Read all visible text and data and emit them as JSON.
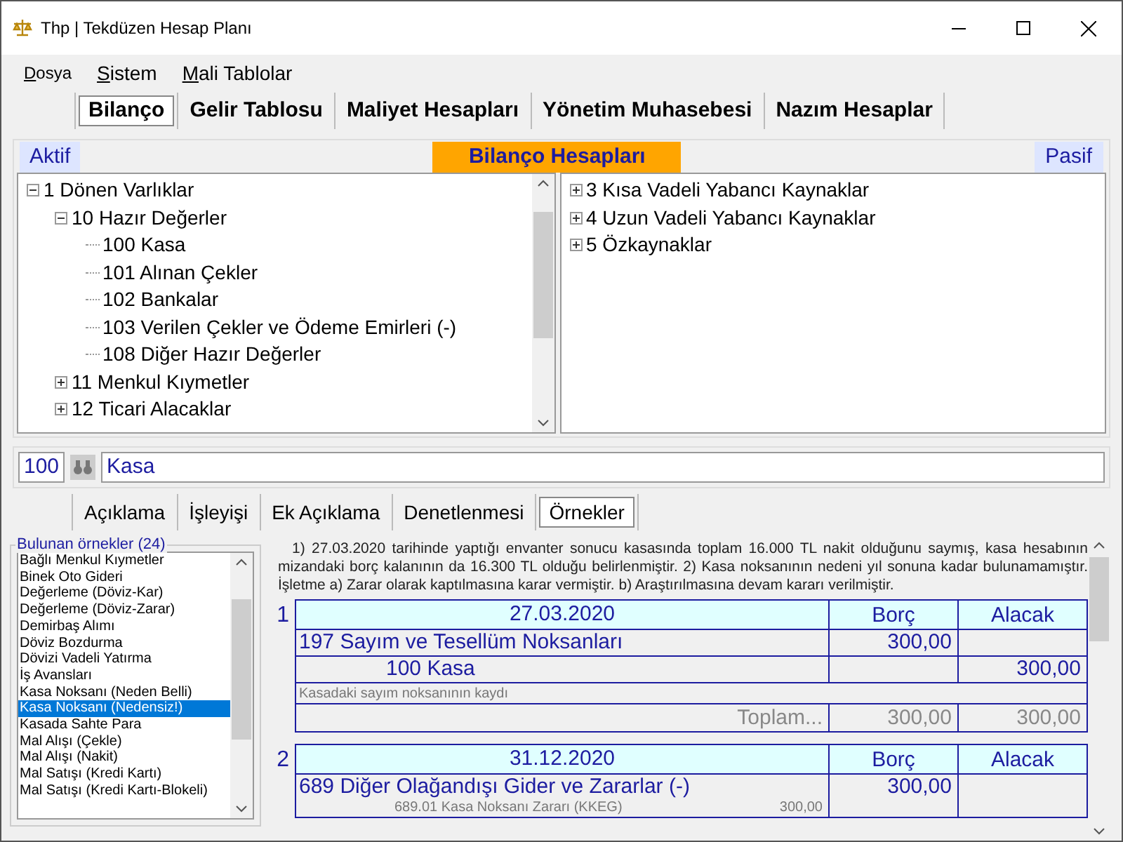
{
  "window": {
    "title": "Thp | Tekdüzen Hesap Planı"
  },
  "menu": [
    {
      "label": "Dosya",
      "kind": "small"
    },
    {
      "label": "Sistem",
      "kind": "normal"
    },
    {
      "label": "Mali Tablolar",
      "kind": "normal"
    }
  ],
  "tabs": [
    {
      "label": "Bilanço",
      "selected": true
    },
    {
      "label": "Gelir Tablosu",
      "selected": false
    },
    {
      "label": "Maliyet Hesapları",
      "selected": false
    },
    {
      "label": "Yönetim Muhasebesi",
      "selected": false
    },
    {
      "label": "Nazım Hesaplar",
      "selected": false
    }
  ],
  "balance_header": {
    "left": "Aktif",
    "title": "Bilanço Hesapları",
    "right": "Pasif"
  },
  "assets_tree": [
    {
      "label": "1 Dönen Varlıklar",
      "expanded": true,
      "children": [
        {
          "label": "10 Hazır Değerler",
          "expanded": true,
          "children": [
            {
              "label": "100 Kasa"
            },
            {
              "label": "101 Alınan Çekler"
            },
            {
              "label": "102 Bankalar"
            },
            {
              "label": "103 Verilen Çekler ve Ödeme Emirleri (-)"
            },
            {
              "label": "108 Diğer Hazır Değerler"
            }
          ]
        },
        {
          "label": "11 Menkul Kıymetler",
          "expanded": false
        },
        {
          "label": "12 Ticari Alacaklar",
          "expanded": false
        }
      ]
    }
  ],
  "liabilities_tree": [
    {
      "label": "3 Kısa Vadeli Yabancı Kaynaklar",
      "expanded": false
    },
    {
      "label": "4 Uzun Vadeli Yabancı Kaynaklar",
      "expanded": false
    },
    {
      "label": "5 Özkaynaklar",
      "expanded": false
    }
  ],
  "account_search": {
    "code": "100",
    "name": "Kasa"
  },
  "detail_tabs": [
    {
      "label": "Açıklama",
      "selected": false
    },
    {
      "label": "İşleyişi",
      "selected": false
    },
    {
      "label": "Ek Açıklama",
      "selected": false
    },
    {
      "label": "Denetlenmesi",
      "selected": false
    },
    {
      "label": "Örnekler",
      "selected": true
    }
  ],
  "examples": {
    "title": "Bulunan örnekler (24)",
    "items": [
      {
        "label": "Bağlı Menkul Kıymetler",
        "selected": false
      },
      {
        "label": "Binek Oto Gideri",
        "selected": false
      },
      {
        "label": "Değerleme (Döviz-Kar)",
        "selected": false
      },
      {
        "label": "Değerleme (Döviz-Zarar)",
        "selected": false
      },
      {
        "label": "Demirbaş Alımı",
        "selected": false
      },
      {
        "label": "Döviz Bozdurma",
        "selected": false
      },
      {
        "label": "Dövizi Vadeli Yatırma",
        "selected": false
      },
      {
        "label": "İş Avansları",
        "selected": false
      },
      {
        "label": "Kasa Noksanı (Neden Belli)",
        "selected": false
      },
      {
        "label": "Kasa Noksanı (Nedensiz!)",
        "selected": true
      },
      {
        "label": "Kasada Sahte Para",
        "selected": false
      },
      {
        "label": "Mal Alışı (Çekle)",
        "selected": false
      },
      {
        "label": "Mal Alışı (Nakit)",
        "selected": false
      },
      {
        "label": "Mal Satışı (Kredi Kartı)",
        "selected": false
      },
      {
        "label": "Mal Satışı (Kredi Kartı-Blokeli)",
        "selected": false
      }
    ]
  },
  "description": "1) 27.03.2020 tarihinde yaptığı envanter sonucu kasasında toplam 16.000 TL nakit olduğunu saymış, kasa hesabının mizandaki borç kalanının da 16.300 TL olduğu belirlenmiştir. 2) Kasa noksanının nedeni yıl sonuna kadar bulunamamıştır. İşletme a) Zarar olarak kaptılmasına karar vermiştir. b) Araştırılmasına devam kararı verilmiştir.",
  "entries": [
    {
      "number": "1",
      "date": "27.03.2020",
      "debit_header": "Borç",
      "credit_header": "Alacak",
      "lines": [
        {
          "kind": "debit",
          "account": "197 Sayım ve Tesellüm Noksanları",
          "amount": "300,00"
        },
        {
          "kind": "credit",
          "account": "100 Kasa",
          "amount": "300,00"
        }
      ],
      "note": "Kasadaki sayım noksanının kaydı",
      "total": {
        "label": "Toplam...",
        "debit": "300,00",
        "credit": "300,00"
      }
    },
    {
      "number": "2",
      "date": "31.12.2020",
      "debit_header": "Borç",
      "credit_header": "Alacak",
      "lines": [
        {
          "kind": "debit",
          "account": "689 Diğer Olağandışı Gider ve Zararlar (-)",
          "amount": "300,00",
          "sub": [
            {
              "account": "689.01 Kasa Noksanı Zararı (KKEG)",
              "amount": "300,00"
            }
          ]
        }
      ]
    }
  ]
}
